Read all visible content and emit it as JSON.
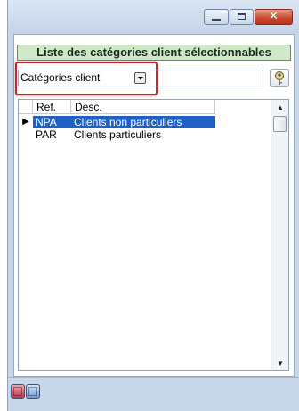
{
  "window": {
    "controls": {
      "minimize": "minimize",
      "maximize": "maximize",
      "close": "close"
    }
  },
  "panel": {
    "title": "Liste des catégories client sélectionnables"
  },
  "filter": {
    "combo_value": "Catégories client",
    "input_value": "",
    "search_icon": "search-key-icon"
  },
  "grid": {
    "columns": [
      "Ref.",
      "Desc."
    ],
    "rows": [
      {
        "ref": "NPA",
        "desc": "Clients non particuliers",
        "selected": true,
        "indicator": "▶"
      },
      {
        "ref": "PAR",
        "desc": "Clients particuliers",
        "selected": false,
        "indicator": ""
      }
    ],
    "scroll_up": "▲",
    "scroll_down": "▼"
  },
  "bottom": {
    "buttons": [
      "red-list-icon",
      "blue-list-icon"
    ]
  }
}
